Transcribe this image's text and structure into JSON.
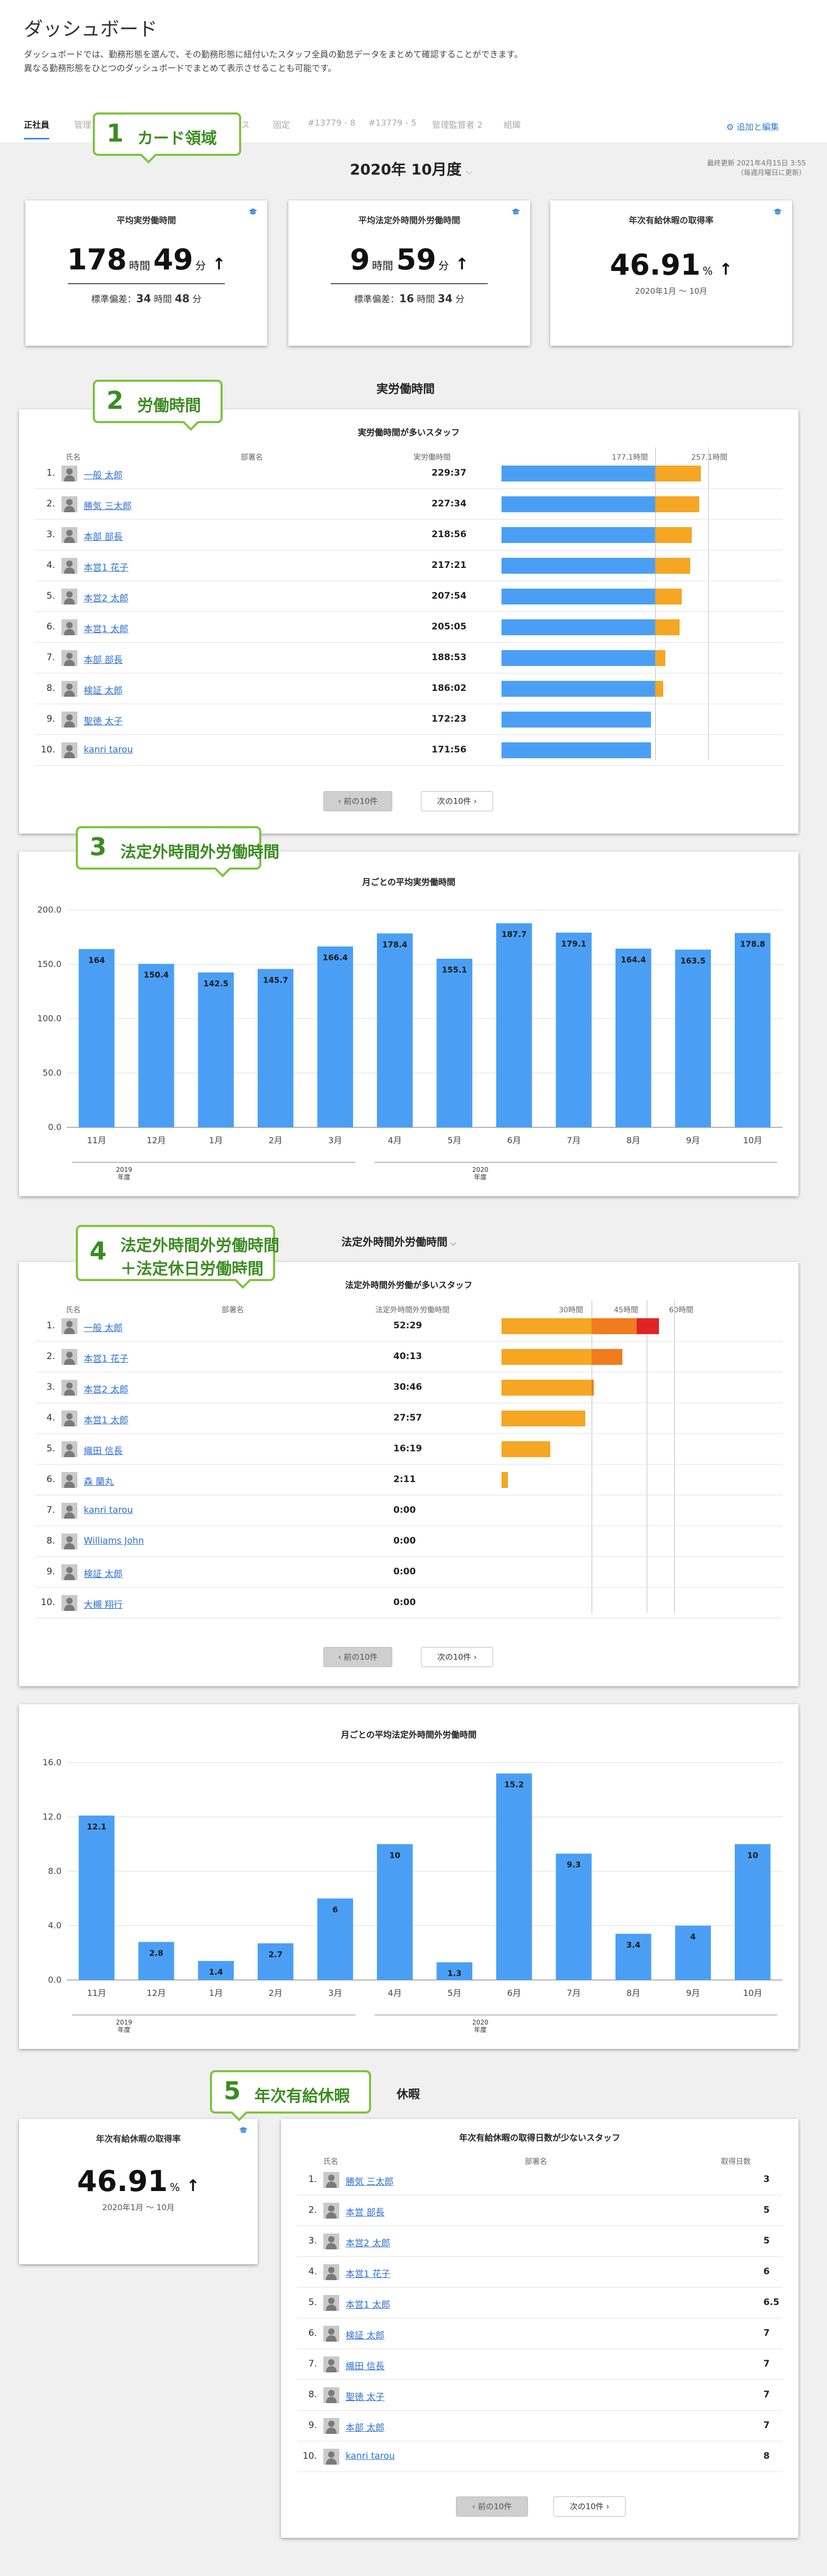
{
  "header": {
    "title": "ダッシュボード",
    "desc1": "ダッシュボードでは、勤務形態を選んで、その勤務形態に紐付いたスタッフ全員の勤怠データをまとめて確認することができます。",
    "desc2": "異なる勤務形態をひとつのダッシュボードでまとめて表示させることも可能です。",
    "tabs": [
      "正社員",
      "管理",
      "ス",
      "固定",
      "#13779 - 8",
      "#13779 - 5",
      "管理監督者 2",
      "組織"
    ],
    "add_edit": "追加と編集"
  },
  "period": {
    "label": "2020年 10月度"
  },
  "updated": {
    "line1": "最終更新 2021年4月15日 3:55",
    "line2": "（毎週月曜日に更新）"
  },
  "callouts": {
    "c1": {
      "num": "1",
      "label": "カード領域"
    },
    "c2": {
      "num": "2",
      "label": "労働時間"
    },
    "c3": {
      "num": "3",
      "label": "法定外時間外労働時間"
    },
    "c4": {
      "num": "4",
      "label1": "法定外時間外労働時間",
      "label2": "＋法定休日労働時間"
    },
    "c5": {
      "num": "5",
      "label": "年次有給休暇"
    }
  },
  "kpis": {
    "avg_work": {
      "title": "平均実労働時間",
      "h": "178",
      "h_unit": "時間",
      "m": "49",
      "m_unit": "分",
      "arrow": "↑",
      "sub_label": "標準偏差：",
      "sub_h": "34",
      "sub_h_unit": "時間",
      "sub_m": "48",
      "sub_m_unit": "分"
    },
    "avg_overtime": {
      "title": "平均法定外時間外労働時間",
      "h": "9",
      "h_unit": "時間",
      "m": "59",
      "m_unit": "分",
      "arrow": "↑",
      "sub_label": "標準偏差：",
      "sub_h": "16",
      "sub_h_unit": "時間",
      "sub_m": "34",
      "sub_m_unit": "分"
    },
    "leave_rate": {
      "title": "年次有給休暇の取得率",
      "value": "46.91",
      "unit": "%",
      "arrow": "↑",
      "sub": "2020年1月 〜 10月"
    }
  },
  "work_section": {
    "title": "実労働時間",
    "panel_title": "実労働時間が多いスタッフ",
    "col_name": "氏名",
    "col_dept": "部署名",
    "col_val": "実労働時間",
    "ref1": "177.1時間",
    "ref2": "257.1時間",
    "rows": [
      {
        "idx": "1.",
        "name": "一般 太郎",
        "value": "229:37"
      },
      {
        "idx": "2.",
        "name": "勝気 三太郎",
        "value": "227:34"
      },
      {
        "idx": "3.",
        "name": "本部 部長",
        "value": "218:56"
      },
      {
        "idx": "4.",
        "name": "本営1 花子",
        "value": "217:21"
      },
      {
        "idx": "5.",
        "name": "本営2 太郎",
        "value": "207:54"
      },
      {
        "idx": "6.",
        "name": "本営1 太郎",
        "value": "205:05"
      },
      {
        "idx": "7.",
        "name": "本部 部長",
        "value": "188:53"
      },
      {
        "idx": "8.",
        "name": "検証 太郎",
        "value": "186:02"
      },
      {
        "idx": "9.",
        "name": "聖徳 太子",
        "value": "172:23"
      },
      {
        "idx": "10.",
        "name": "kanri tarou",
        "value": "171:56"
      }
    ],
    "prev": "前の10件",
    "next": "次の10件"
  },
  "monthly_work_chart": {
    "title": "月ごとの平均実労働時間",
    "year1": "2019",
    "year2": "2020",
    "fiscal": "年度"
  },
  "overtime_section": {
    "title": "法定外時間外労働時間",
    "panel_title": "法定外時間外労働が多いスタッフ",
    "col_name": "氏名",
    "col_dept": "部署名",
    "col_val": "法定外時間外労働時間",
    "ref1": "30時間",
    "ref2": "45時間",
    "ref3": "60時間",
    "rows": [
      {
        "idx": "1.",
        "name": "一般 太郎",
        "value": "52:29"
      },
      {
        "idx": "2.",
        "name": "本営1 花子",
        "value": "40:13"
      },
      {
        "idx": "3.",
        "name": "本営2 太郎",
        "value": "30:46"
      },
      {
        "idx": "4.",
        "name": "本営1 太郎",
        "value": "27:57"
      },
      {
        "idx": "5.",
        "name": "織田 信長",
        "value": "16:19"
      },
      {
        "idx": "6.",
        "name": "森 蘭丸",
        "value": "2:11"
      },
      {
        "idx": "7.",
        "name": "kanri tarou",
        "value": "0:00"
      },
      {
        "idx": "8.",
        "name": "Williams John",
        "value": "0:00"
      },
      {
        "idx": "9.",
        "name": "検証 太郎",
        "value": "0:00"
      },
      {
        "idx": "10.",
        "name": "大槻 翔行",
        "value": "0:00"
      }
    ],
    "prev": "前の10件",
    "next": "次の10件"
  },
  "monthly_overtime_chart": {
    "title": "月ごとの平均法定外時間外労働時間",
    "year1": "2019",
    "year2": "2020",
    "fiscal": "年度"
  },
  "leave_section": {
    "title": "休暇",
    "card_title": "年次有給休暇の取得率",
    "value": "46.91",
    "unit": "%",
    "arrow": "↑",
    "sub": "2020年1月 〜 10月",
    "panel_title": "年次有給休暇の取得日数が少ないスタッフ",
    "col_name": "氏名",
    "col_dept": "部署名",
    "col_val": "取得日数",
    "rows": [
      {
        "idx": "1.",
        "name": "勝気 三太郎",
        "value": "3"
      },
      {
        "idx": "2.",
        "name": "本営 部長",
        "value": "5"
      },
      {
        "idx": "3.",
        "name": "本営2 太郎",
        "value": "5"
      },
      {
        "idx": "4.",
        "name": "本営1 花子",
        "value": "6"
      },
      {
        "idx": "5.",
        "name": "本営1 太郎",
        "value": "6.5"
      },
      {
        "idx": "6.",
        "name": "検証 太郎",
        "value": "7"
      },
      {
        "idx": "7.",
        "name": "織田 信長",
        "value": "7"
      },
      {
        "idx": "8.",
        "name": "聖徳 太子",
        "value": "7"
      },
      {
        "idx": "9.",
        "name": "本部 太郎",
        "value": "7"
      },
      {
        "idx": "10.",
        "name": "kanri tarou",
        "value": "8"
      }
    ],
    "prev": "前の10件",
    "next": "次の10件"
  },
  "colors": {
    "accent": "#3a8ee6",
    "bar_blue": "#4a9ff5",
    "bar_orange": "#f5a623",
    "bar_deep_orange": "#f07c1e",
    "bar_red": "#e02424",
    "callout_green": "#7fc341"
  },
  "chart_data": [
    {
      "type": "bar",
      "title": "月ごとの平均実労働時間",
      "categories": [
        "11月",
        "12月",
        "1月",
        "2月",
        "3月",
        "4月",
        "5月",
        "6月",
        "7月",
        "8月",
        "9月",
        "10月"
      ],
      "values": [
        164,
        150.4,
        142.5,
        145.7,
        166.4,
        178.4,
        155.1,
        187.7,
        179.1,
        164.4,
        163.5,
        178.8
      ],
      "ylim": [
        0,
        200
      ],
      "yticks": [
        "0.0",
        "50.0",
        "100.0",
        "150.0",
        "200.0"
      ],
      "grid": true
    },
    {
      "type": "bar",
      "title": "月ごとの平均法定外時間外労働時間",
      "categories": [
        "11月",
        "12月",
        "1月",
        "2月",
        "3月",
        "4月",
        "5月",
        "6月",
        "7月",
        "8月",
        "9月",
        "10月"
      ],
      "values": [
        12.1,
        2.8,
        1.4,
        2.7,
        6,
        10,
        1.3,
        15.2,
        9.3,
        3.4,
        4,
        10
      ],
      "ylim": [
        0,
        16
      ],
      "yticks": [
        "0.0",
        "4.0",
        "8.0",
        "12.0",
        "16.0"
      ],
      "grid": true
    }
  ]
}
